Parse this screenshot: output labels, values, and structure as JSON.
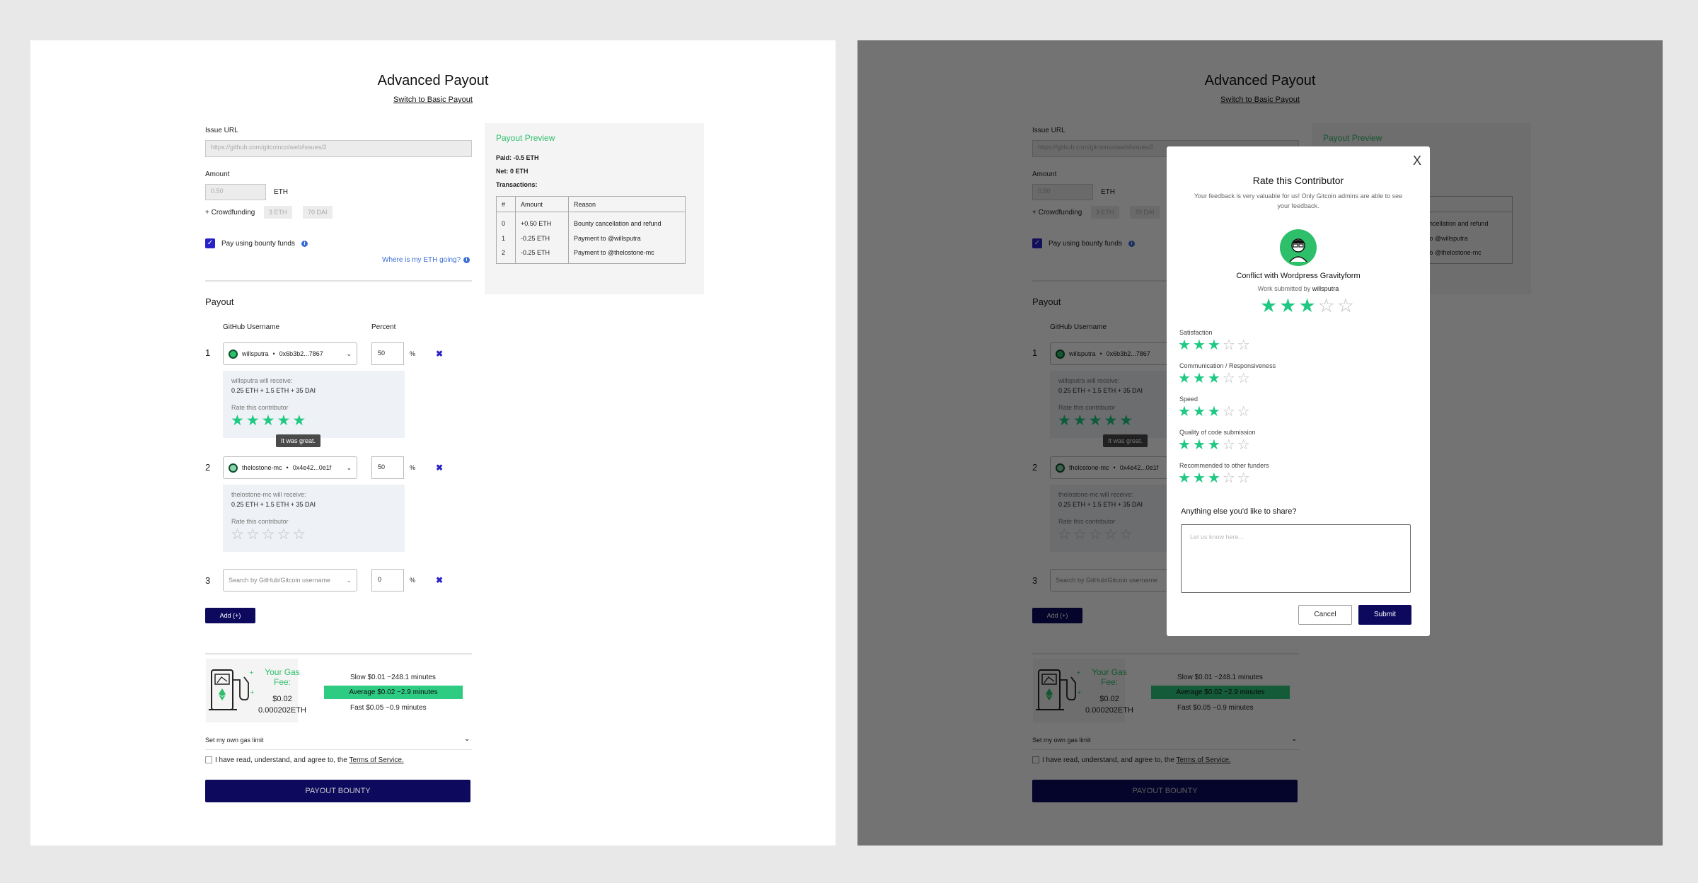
{
  "form": {
    "title": "Advanced Payout",
    "switch_link": "Switch to Basic Payout",
    "issue_url_label": "Issue URL",
    "issue_url_placeholder": "https://github.com/gitcoinco/web/issues/2",
    "amount_label": "Amount",
    "amount_value": "0.50",
    "amount_unit": "ETH",
    "crowdfunding_label": "+ Crowdfunding",
    "crowdfunding_chips": [
      "3 ETH",
      "70 DAI"
    ],
    "pay_with_bounty_label": "Pay using bounty funds",
    "pay_with_bounty_checked": true,
    "where_eth_link": "Where is my ETH going?",
    "payout_heading": "Payout",
    "col_username": "GitHub Username",
    "col_percent": "Percent",
    "percent_symbol": "%",
    "rows": [
      {
        "num": "1",
        "user": "willsputra",
        "address": "0x6b3b2...7867",
        "percent": "50",
        "receive_label": "willsputra will receive:",
        "receive_amount": "0.25 ETH + 1.5 ETH + 35 DAI",
        "rate_label": "Rate this contributor",
        "rating": 5,
        "max_rating": 5,
        "tooltip": "It was great."
      },
      {
        "num": "2",
        "user": "thelostone-mc",
        "address": "0x4e42...0e1f",
        "percent": "50",
        "receive_label": "thelostone-mc will receive:",
        "receive_amount": "0.25 ETH + 1.5 ETH + 35 DAI",
        "rate_label": "Rate this contributor",
        "rating": 0,
        "max_rating": 5
      },
      {
        "num": "3",
        "search_placeholder": "Search by GitHub/Gitcoin username",
        "percent": "0"
      }
    ],
    "add_button": "Add (+)",
    "gas_title": "Your Gas Fee:",
    "gas_usd": "$0.02",
    "gas_eth": "0.000202ETH",
    "gas_options": [
      {
        "label": "Slow $0.01 ~248.1 minutes",
        "selected": false
      },
      {
        "label": "Average $0.02 ~2.9 minutes",
        "selected": true
      },
      {
        "label": "Fast $0.05 ~0.9 minutes",
        "selected": false
      }
    ],
    "gas_limit_label": "Set my own gas limit",
    "tos_prefix": "I have read, understand, and agree to, the",
    "tos_link": "Terms of Service.",
    "payout_button": "PAYOUT BOUNTY"
  },
  "preview": {
    "title": "Payout Preview",
    "paid": "Paid: -0.5 ETH",
    "net": "Net: 0 ETH",
    "transactions_label": "Transactions:",
    "columns": [
      "#",
      "Amount",
      "Reason"
    ],
    "rows": [
      [
        "0",
        "+0.50 ETH",
        "Bounty cancellation and refund"
      ],
      [
        "1",
        "-0.25 ETH",
        "Payment to @willsputra"
      ],
      [
        "2",
        "-0.25 ETH",
        "Payment to @thelostone-mc"
      ]
    ]
  },
  "modal": {
    "close": "X",
    "title": "Rate this Contributor",
    "subtitle": "Your feedback is very valuable for us! Only Gitcoin admins are able to see your feedback.",
    "issue_title": "Conflict with Wordpress Gravityform",
    "work_prefix": "Work submitted by",
    "work_user": "willsputra",
    "overall_rating": 3,
    "max_rating": 5,
    "criteria": [
      {
        "label": "Satisfaction",
        "rating": 3
      },
      {
        "label": "Communication / Responsiveness",
        "rating": 3
      },
      {
        "label": "Speed",
        "rating": 3
      },
      {
        "label": "Quality of code submission",
        "rating": 3
      },
      {
        "label": "Recommended to other funders",
        "rating": 3
      }
    ],
    "question": "Anything else you'd like to share?",
    "textarea_placeholder": "Let us know here...",
    "cancel": "Cancel",
    "submit": "Submit"
  },
  "colors": {
    "navy": "#0d0a5e",
    "green": "#2dbf6a",
    "star_green": "#20c983",
    "checkbox_blue": "#2a22c9"
  },
  "icons": [
    "info-icon",
    "chevron-down-icon",
    "remove-icon",
    "star-icon",
    "gas-pump-icon",
    "ethereum-icon",
    "close-icon",
    "avatar-icon"
  ]
}
